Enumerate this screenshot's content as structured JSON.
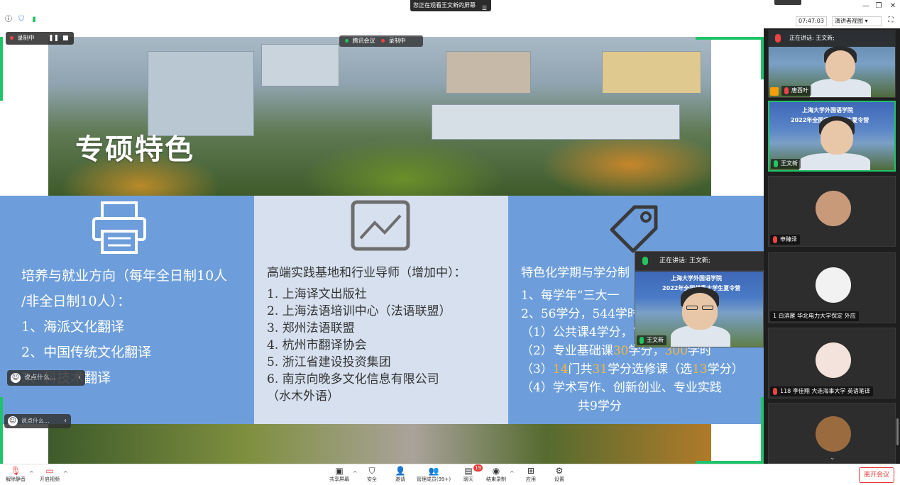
{
  "top_bar": {
    "banner": "您正在观看王文新的屏幕",
    "clock": "07:47:03",
    "view_mode": "演讲者视图 ▾"
  },
  "share": {
    "recording_label": "录制中",
    "meeting_badge": {
      "app": "腾讯会议",
      "recording": "录制中"
    },
    "slide": {
      "title": "专硕特色",
      "col1": [
        "培养与就业方向（每年全日制10人",
        "/非全日制10人）：",
        "1、海派文化翻译",
        "2、中国传统文化翻译",
        "3、科技术翻译"
      ],
      "col2": {
        "heading": "高端实践基地和行业导师（增加中）：",
        "items": [
          "1.  上海译文出版社",
          "2.  上海法语培训中心（法语联盟）",
          "3.  郑州法语联盟",
          "4.  杭州市翻译协会",
          "5.  浙江省建设投资集团",
          "6.  南京向晚多文化信息有限公司",
          "     （水木外语）"
        ]
      },
      "col3": {
        "heading": "特色化学期与学分制",
        "l1": "1、每学年“三大一",
        "l2": "2、56学分，544学时",
        "l3": "（1）公共课4学分，74学时",
        "l4a": "（2）专业基础课",
        "l4b": "30",
        "l4c": "学分，",
        "l4d": "300",
        "l4e": "学时",
        "l5a": "（3）",
        "l5b": "14",
        "l5c": "门共",
        "l5d": "31",
        "l5e": "学分选修课（选",
        "l5f": "13",
        "l5g": "学分）",
        "l6": "（4）学术写作、创新创业、专业实践",
        "l7": "共9学分"
      }
    },
    "chat_placeholder": "说点什么...",
    "floating_video": {
      "speaking": "正在讲话: 王文新;",
      "name": "王文新",
      "banner_line1": "上海大学外国语学院",
      "banner_line2": "2022年全国优秀大学生夏令营"
    }
  },
  "participants": {
    "speaking": "正在讲话: 王文新;",
    "tiles": [
      {
        "name": "唐酉叶",
        "mic": "off"
      },
      {
        "name": "王文新",
        "mic": "on",
        "banner1": "上海大学外国语学院",
        "banner2": "2022年全国优秀大学生夏令营"
      },
      {
        "name": "申臻泽",
        "mic": "off"
      },
      {
        "name": "1 白滨雁 华北电力大学保定 外应",
        "mic": "off"
      },
      {
        "name": "118 李佳翔 大连海事大学 英语笔译",
        "mic": "off"
      },
      {
        "name": "",
        "mic": "off"
      }
    ]
  },
  "toolbar": {
    "unmute": "解除静音",
    "start_video": "开启视频",
    "share_screen": "共享屏幕",
    "security": "安全",
    "invite": "邀请",
    "manage_members": "管理成员(99+)",
    "chat": "聊天",
    "chat_badge": "19",
    "end_recording": "结束录制",
    "apps": "应用",
    "settings": "设置",
    "leave": "离开会议"
  }
}
